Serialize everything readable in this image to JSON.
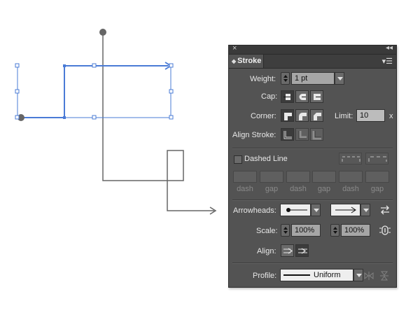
{
  "panel": {
    "tab_title": "Stroke",
    "close_glyph": "×",
    "collapse_glyph": "◂◂",
    "menu_glyph": "▾☰",
    "tab_arrow": "◆",
    "weight": {
      "label": "Weight:",
      "value": "1 pt"
    },
    "cap": {
      "label": "Cap:"
    },
    "corner": {
      "label": "Corner:",
      "limit_label": "Limit:",
      "limit_value": "10",
      "limit_unit": "x"
    },
    "align_stroke": {
      "label": "Align Stroke:"
    },
    "dashed_line": {
      "label": "Dashed Line",
      "checked": false
    },
    "dash_gap_labels": [
      "dash",
      "gap",
      "dash",
      "gap",
      "dash",
      "gap"
    ],
    "arrowheads": {
      "label": "Arrowheads:"
    },
    "scale": {
      "label": "Scale:",
      "start": "100%",
      "end": "100%"
    },
    "align": {
      "label": "Align:"
    },
    "profile": {
      "label": "Profile:",
      "value": "Uniform"
    }
  },
  "colors": {
    "panel_bg": "#535353",
    "selection_blue": "#4a7bd6",
    "path_gray": "#666666"
  },
  "icons": [
    "close-icon",
    "collapse-icon",
    "panel-menu-icon",
    "butt-cap-icon",
    "round-cap-icon",
    "projecting-cap-icon",
    "miter-join-icon",
    "round-join-icon",
    "bevel-join-icon",
    "align-center-icon",
    "align-inside-icon",
    "align-outside-icon",
    "dash-preserve-icon",
    "dash-align-corners-icon",
    "swap-arrowheads-icon",
    "link-scale-icon",
    "arrow-extend-icon",
    "arrow-place-at-end-icon",
    "flip-along-icon",
    "flip-across-icon"
  ]
}
